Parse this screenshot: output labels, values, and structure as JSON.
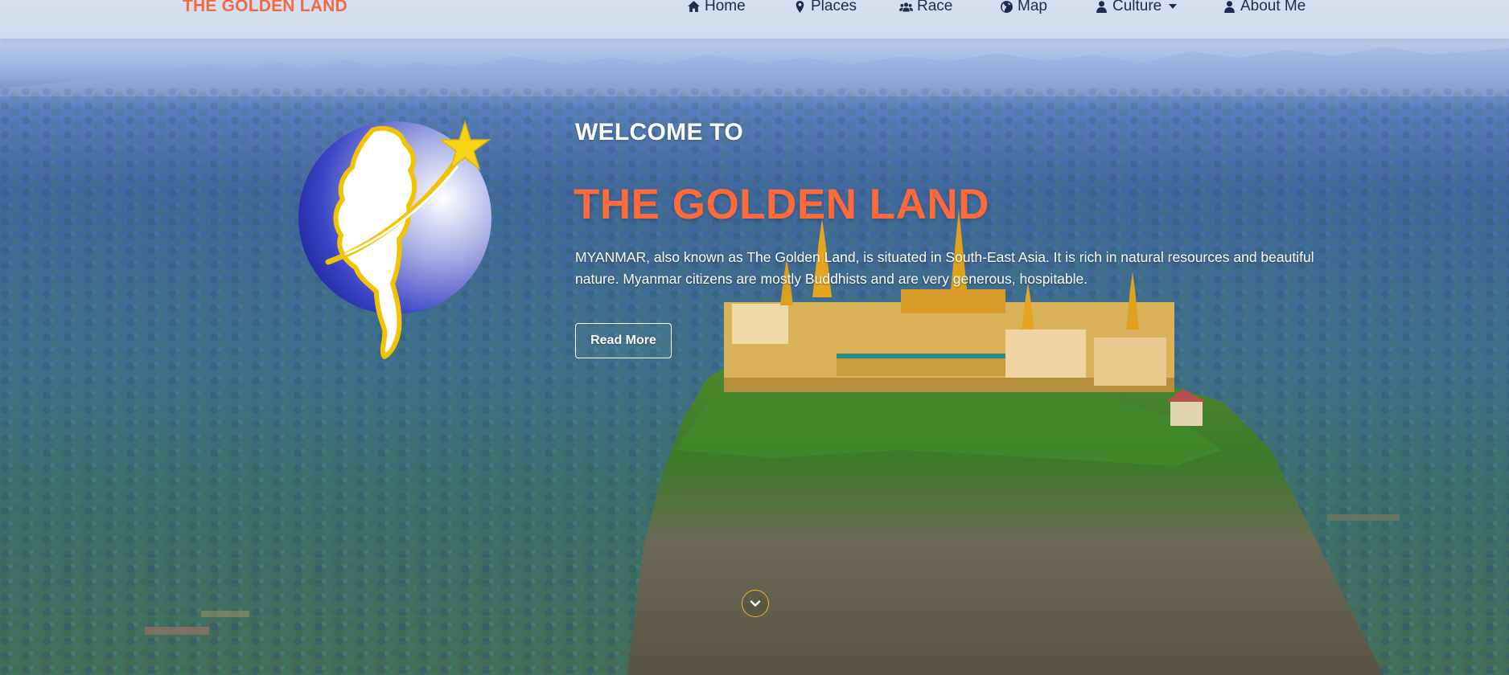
{
  "navbar": {
    "brand": "THE GOLDEN LAND",
    "items": [
      {
        "label": "Home",
        "icon": "home-icon"
      },
      {
        "label": "Places",
        "icon": "map-marker-icon"
      },
      {
        "label": "Race",
        "icon": "users-icon"
      },
      {
        "label": "Map",
        "icon": "globe-icon"
      },
      {
        "label": "Culture",
        "icon": "user-icon",
        "dropdown": true
      },
      {
        "label": "About Me",
        "icon": "user-icon"
      }
    ]
  },
  "hero": {
    "welcome": "WELCOME TO",
    "headline": "THE GOLDEN LAND",
    "description": "MYANMAR, also known as The Golden Land, is situated in South-East Asia. It is rich in natural resources and beautiful nature. Myanmar citizens are mostly Buddhists and are very generous, hospitable.",
    "button_label": "Read More",
    "scroll_icon": "chevron-down-icon",
    "logo_icon": "myanmar-map-star-logo"
  },
  "colors": {
    "brand": "#f26a43",
    "headline": "#ff6a3d",
    "nav_text": "#1f2b4a",
    "scroll_ring": "#f0b429"
  }
}
